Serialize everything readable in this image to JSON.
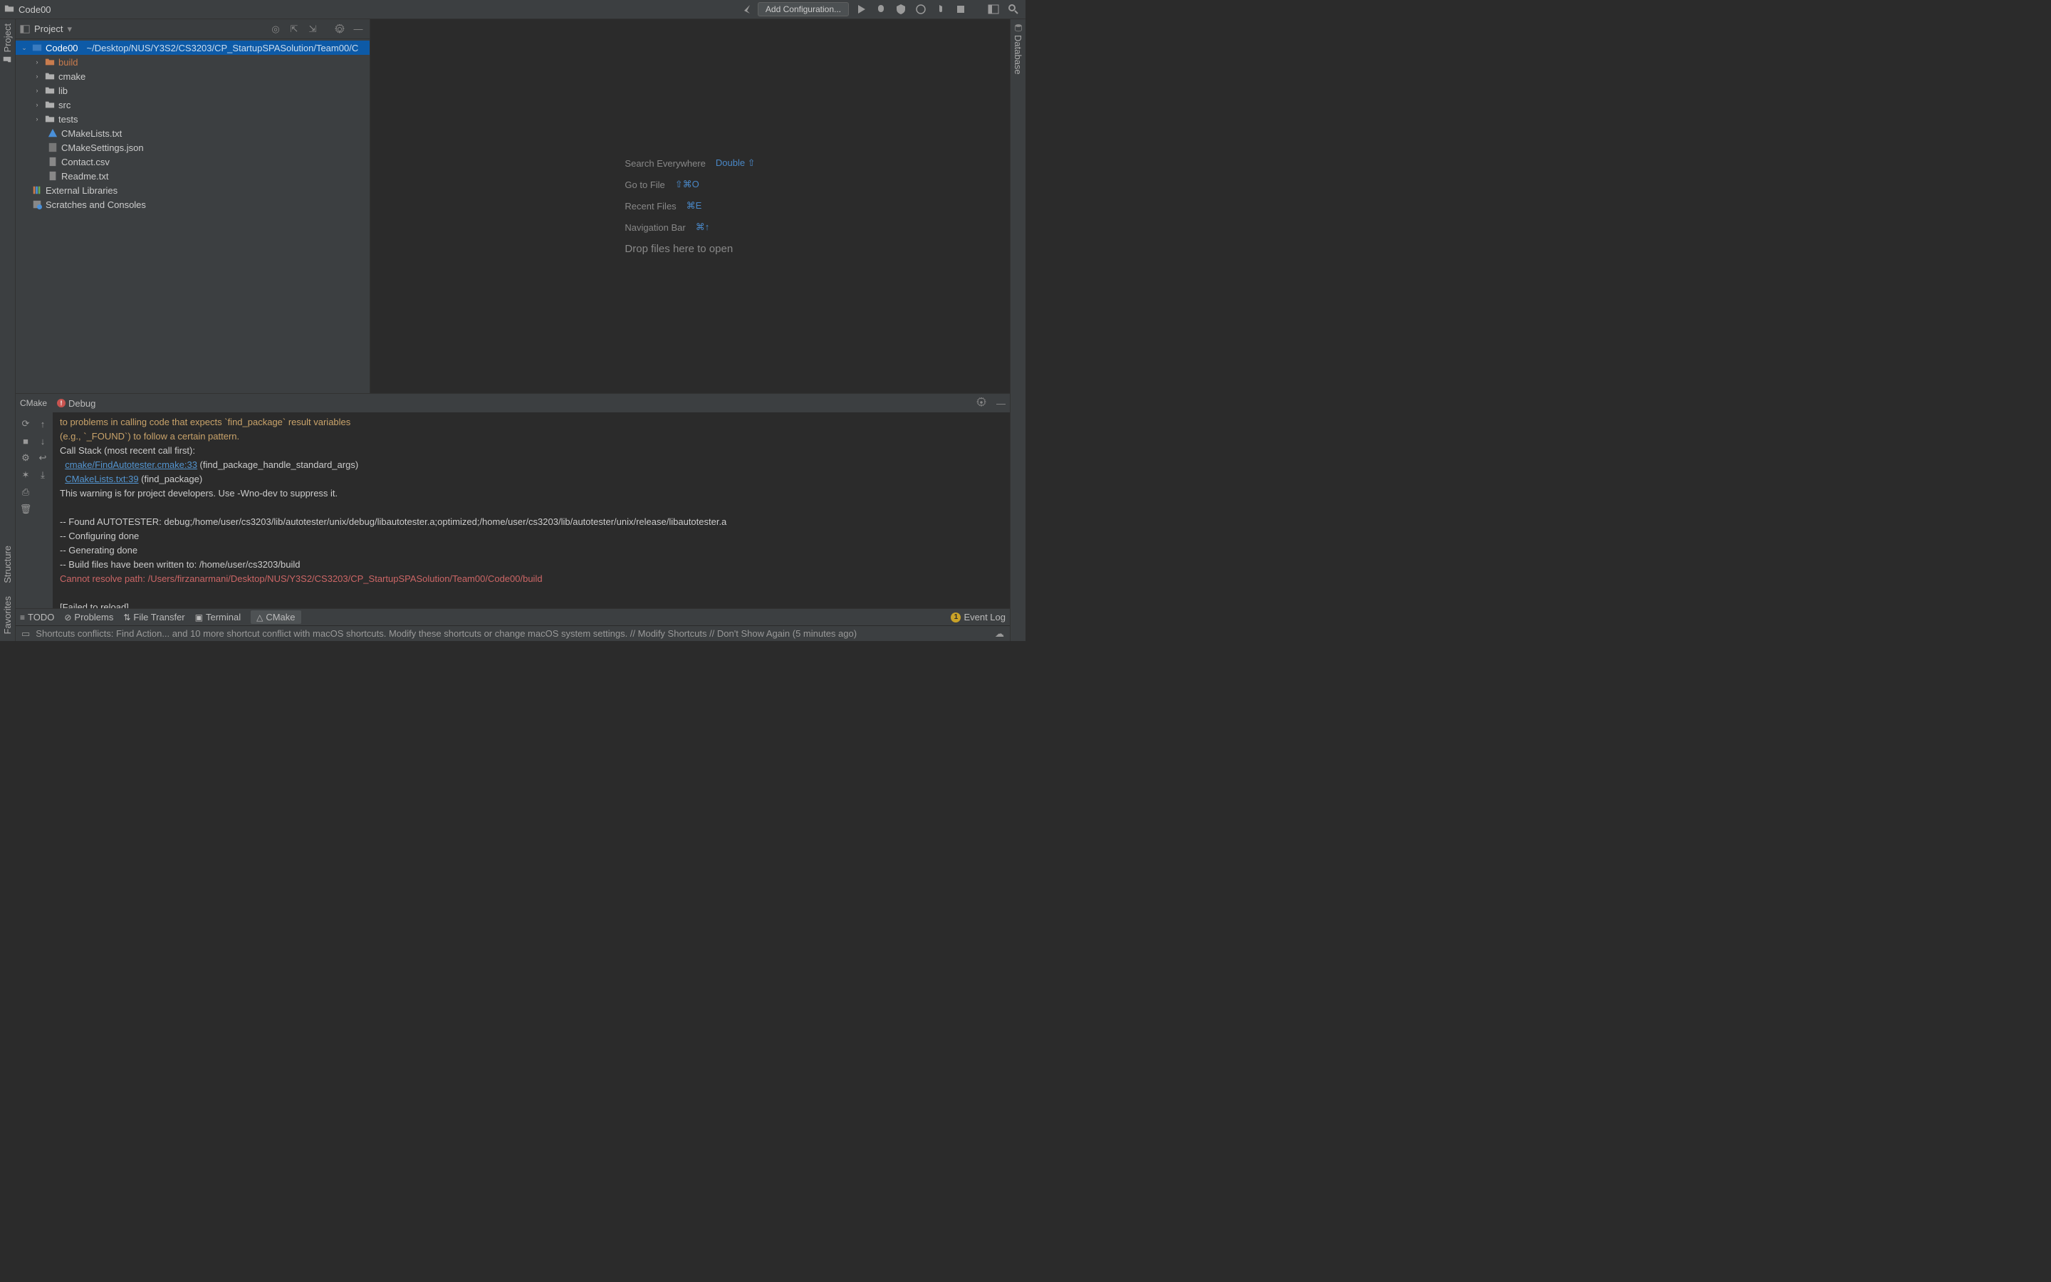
{
  "window": {
    "title": "Code00"
  },
  "toolbar": {
    "add_config": "Add Configuration..."
  },
  "left_rail": {
    "project": "Project",
    "structure": "Structure",
    "favorites": "Favorites"
  },
  "right_rail": {
    "database": "Database"
  },
  "project_tool": {
    "title": "Project"
  },
  "tree": {
    "root": {
      "name": "Code00",
      "path": "~/Desktop/NUS/Y3S2/CS3203/CP_StartupSPASolution/Team00/C"
    },
    "children": [
      {
        "name": "build",
        "kind": "folder-excluded",
        "chev": "›"
      },
      {
        "name": "cmake",
        "kind": "folder",
        "chev": "›"
      },
      {
        "name": "lib",
        "kind": "folder",
        "chev": "›"
      },
      {
        "name": "src",
        "kind": "folder",
        "chev": "›"
      },
      {
        "name": "tests",
        "kind": "folder",
        "chev": "›"
      },
      {
        "name": "CMakeLists.txt",
        "kind": "cmake"
      },
      {
        "name": "CMakeSettings.json",
        "kind": "json"
      },
      {
        "name": "Contact.csv",
        "kind": "file"
      },
      {
        "name": "Readme.txt",
        "kind": "file"
      }
    ],
    "external": "External Libraries",
    "scratches": "Scratches and Consoles"
  },
  "hints": {
    "search": {
      "label": "Search Everywhere",
      "key": "Double ⇧"
    },
    "gotofile": {
      "label": "Go to File",
      "key": "⇧⌘O"
    },
    "recent": {
      "label": "Recent Files",
      "key": "⌘E"
    },
    "navbar": {
      "label": "Navigation Bar",
      "key": "⌘↑"
    },
    "drop": "Drop files here to open"
  },
  "bottom_tabs": {
    "cmake": "CMake",
    "debug": "Debug"
  },
  "console": {
    "l1": "  to problems in calling code that expects `find_package` result variables",
    "l2": "  (e.g., `_FOUND`) to follow a certain pattern.",
    "l3": "Call Stack (most recent call first):",
    "l4a": "cmake/FindAutotester.cmake:33",
    "l4b": " (find_package_handle_standard_args)",
    "l5a": "CMakeLists.txt:39",
    "l5b": " (find_package)",
    "l6": "This warning is for project developers.  Use -Wno-dev to suppress it.",
    "l8": "-- Found AUTOTESTER: debug;/home/user/cs3203/lib/autotester/unix/debug/libautotester.a;optimized;/home/user/cs3203/lib/autotester/unix/release/libautotester.a",
    "l9": "-- Configuring done",
    "l10": "-- Generating done",
    "l11": "-- Build files have been written to: /home/user/cs3203/build",
    "l12": "Cannot resolve path: /Users/firzanarmani/Desktop/NUS/Y3S2/CS3203/CP_StartupSPASolution/Team00/Code00/build",
    "l14": "[Failed to reload]"
  },
  "bottombar": {
    "todo": "TODO",
    "problems": "Problems",
    "filetransfer": "File Transfer",
    "terminal": "Terminal",
    "cmake": "CMake",
    "eventlog": "Event Log",
    "event_count": "1"
  },
  "status": {
    "msg": "Shortcuts conflicts: Find Action... and 10 more shortcut conflict with macOS shortcuts. Modify these shortcuts or change macOS system settings. // Modify Shortcuts // Don't Show Again (5 minutes ago)"
  }
}
